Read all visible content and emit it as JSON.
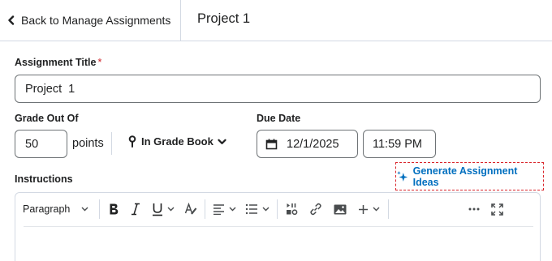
{
  "header": {
    "back_label": "Back to Manage Assignments",
    "title": "Project 1"
  },
  "form": {
    "title_label": "Assignment Title",
    "required_mark": "*",
    "title_value": "Project  1",
    "grade_label": "Grade Out Of",
    "grade_value": "50",
    "points_label": "points",
    "gradebook_label": "In Grade Book",
    "due_label": "Due Date",
    "due_date": "12/1/2025",
    "due_time": "11:59 PM",
    "instructions_label": "Instructions",
    "generate_label": "Generate Assignment Ideas"
  },
  "editor": {
    "format_value": "Paragraph",
    "tools": [
      "bold-icon",
      "italic-icon",
      "underline-icon",
      "text-color-icon",
      "align-icon",
      "list-icon",
      "insert-stuff-icon",
      "link-icon",
      "image-icon",
      "insert-plus-icon",
      "more-icon",
      "fullscreen-icon"
    ]
  },
  "colors": {
    "accent_link": "#006fbf",
    "highlight_dash": "#d9262c",
    "border": "#6e7376",
    "divider": "#d3d9e3"
  }
}
